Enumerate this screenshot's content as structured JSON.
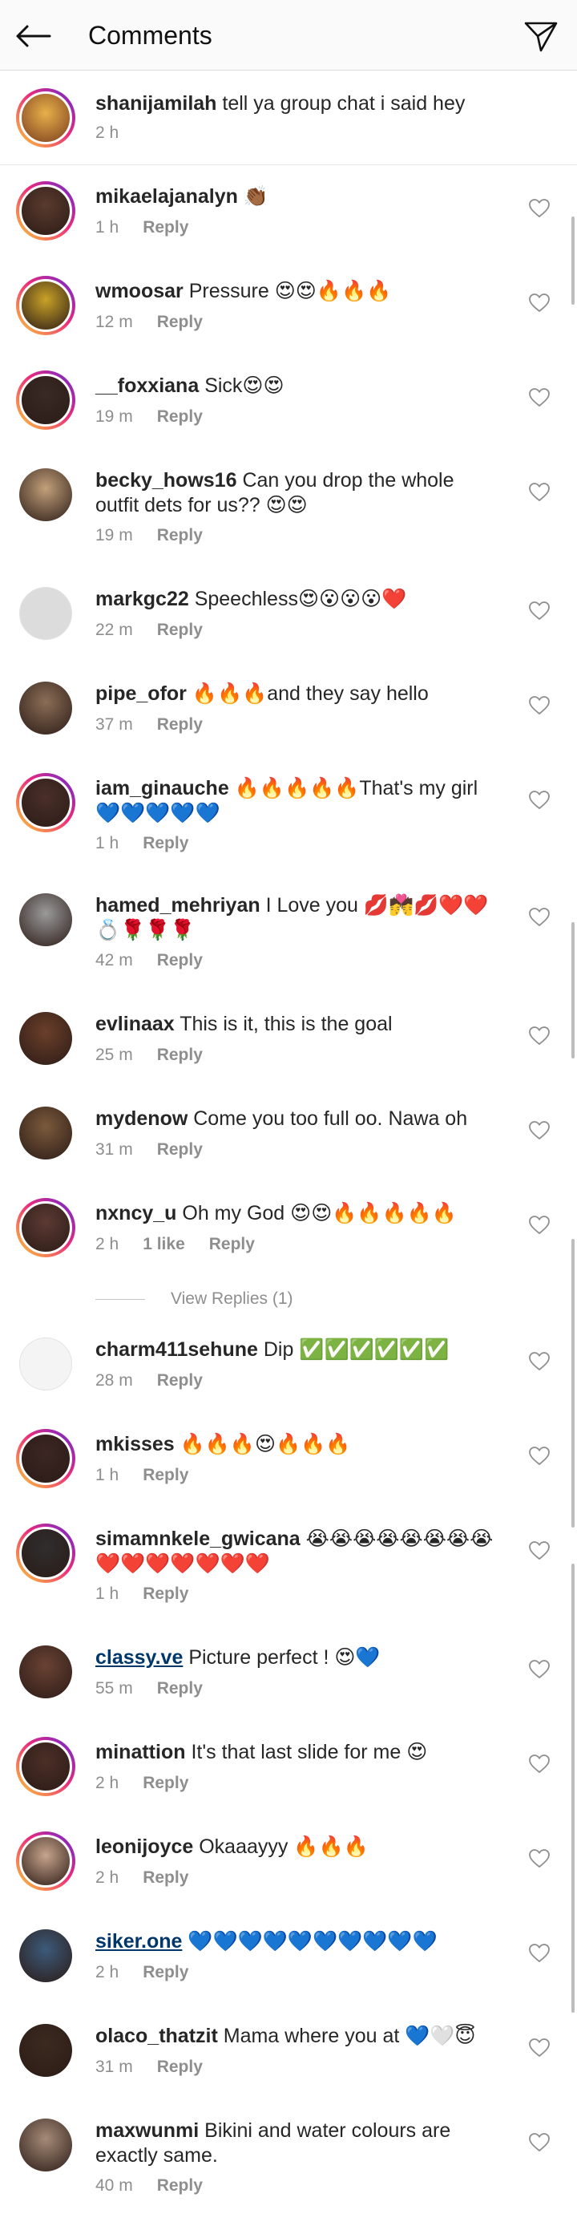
{
  "header": {
    "title": "Comments",
    "back_icon": "arrow-left-icon",
    "send_icon": "paper-plane-icon"
  },
  "caption": {
    "username": "shanijamilah",
    "text": "tell ya group chat i said hey",
    "time": "2 h"
  },
  "comments": [
    {
      "username": "mikaelajanalyn",
      "text": "👏🏾",
      "time": "1 h",
      "reply": "Reply",
      "ring": true,
      "avatar_color": "#5a3b2e"
    },
    {
      "username": "wmoosar",
      "text": "Pressure 😍😍🔥🔥🔥",
      "time": "12 m",
      "reply": "Reply",
      "ring": true,
      "avatar_color": "#c9a227"
    },
    {
      "username": "__foxxiana",
      "text": "Sick😍😍",
      "time": "19 m",
      "reply": "Reply",
      "ring": true,
      "avatar_color": "#3a2a26"
    },
    {
      "username": "becky_hows16",
      "text": "Can you drop the whole outfit dets for us?? 😍😍",
      "time": "19 m",
      "reply": "Reply",
      "ring": false,
      "avatar_color": "#c2a07a"
    },
    {
      "username": "markgc22",
      "text": "Speechless😍😮😮😮❤️",
      "time": "22 m",
      "reply": "Reply",
      "ring": false,
      "avatar_color": "#dcdcdc"
    },
    {
      "username": "pipe_ofor",
      "text": "🔥🔥🔥and they say hello",
      "time": "37 m",
      "reply": "Reply",
      "ring": false,
      "avatar_color": "#8b6e57"
    },
    {
      "username": "iam_ginauche",
      "text": "🔥🔥🔥🔥🔥That's my girl 💙💙💙💙💙",
      "time": "1 h",
      "reply": "Reply",
      "ring": true,
      "avatar_color": "#4a2f2a"
    },
    {
      "username": "hamed_mehriyan",
      "text": "I Love you 💋💏💋❤️❤️💍🌹🌹🌹",
      "time": "42 m",
      "reply": "Reply",
      "ring": false,
      "avatar_color": "#9a9a9a"
    },
    {
      "username": "evlinaax",
      "text": "This is it, this is the goal",
      "time": "25 m",
      "reply": "Reply",
      "ring": false,
      "avatar_color": "#6b3f2a"
    },
    {
      "username": "mydenow",
      "text": "Come you too full oo. Nawa oh",
      "time": "31 m",
      "reply": "Reply",
      "ring": false,
      "avatar_color": "#7b5a3c"
    },
    {
      "username": "nxncy_u",
      "text": "Oh my God 😍😍🔥🔥🔥🔥🔥",
      "time": "2 h",
      "likes": "1 like",
      "reply": "Reply",
      "ring": true,
      "avatar_color": "#5c3a33"
    },
    {
      "username": "charm411sehune",
      "text": "Dip ✅✅✅✅✅✅",
      "time": "28 m",
      "reply": "Reply",
      "ring": false,
      "avatar_color": "#f4f4f4"
    },
    {
      "username": "mkisses",
      "text": "🔥🔥🔥😍🔥🔥🔥",
      "time": "1 h",
      "reply": "Reply",
      "ring": true,
      "avatar_color": "#3b2623"
    },
    {
      "username": "simamnkele_gwicana",
      "text": "😭😭😭😭😭😭😭😭❤️❤️❤️❤️❤️❤️❤️",
      "time": "1 h",
      "reply": "Reply",
      "ring": true,
      "avatar_color": "#2e2e2e"
    },
    {
      "username": "classy.ve",
      "text": "Picture perfect ! 😍💙",
      "time": "55 m",
      "reply": "Reply",
      "ring": false,
      "link": true,
      "avatar_color": "#6a4234"
    },
    {
      "username": "minattion",
      "text": "It's that last slide for me 😍",
      "time": "2 h",
      "reply": "Reply",
      "ring": true,
      "avatar_color": "#4b2f26"
    },
    {
      "username": "leonijoyce",
      "text": "Okaaayyy 🔥🔥🔥",
      "time": "2 h",
      "reply": "Reply",
      "ring": true,
      "avatar_color": "#c7a48c"
    },
    {
      "username": "siker.one",
      "text": "💙💙💙💙💙💙💙💙💙💙",
      "time": "2 h",
      "reply": "Reply",
      "ring": false,
      "link": true,
      "avatar_color": "#3c5a7a"
    },
    {
      "username": "olaco_thatzit",
      "text": "Mama where you at 💙🤍😇",
      "time": "31 m",
      "reply": "Reply",
      "ring": false,
      "avatar_color": "#3a2a1e"
    },
    {
      "username": "maxwunmi",
      "text": "Bikini  and water colours are exactly same.",
      "time": "40 m",
      "reply": "Reply",
      "ring": false,
      "avatar_color": "#a58b78"
    }
  ],
  "view_replies": "View Replies (1)",
  "colors": {
    "ring_start": "#f9ce34",
    "ring_mid": "#ee2a7b",
    "ring_end": "#6228d7",
    "link": "#00376b",
    "meta_gray": "#8e8e8e"
  }
}
